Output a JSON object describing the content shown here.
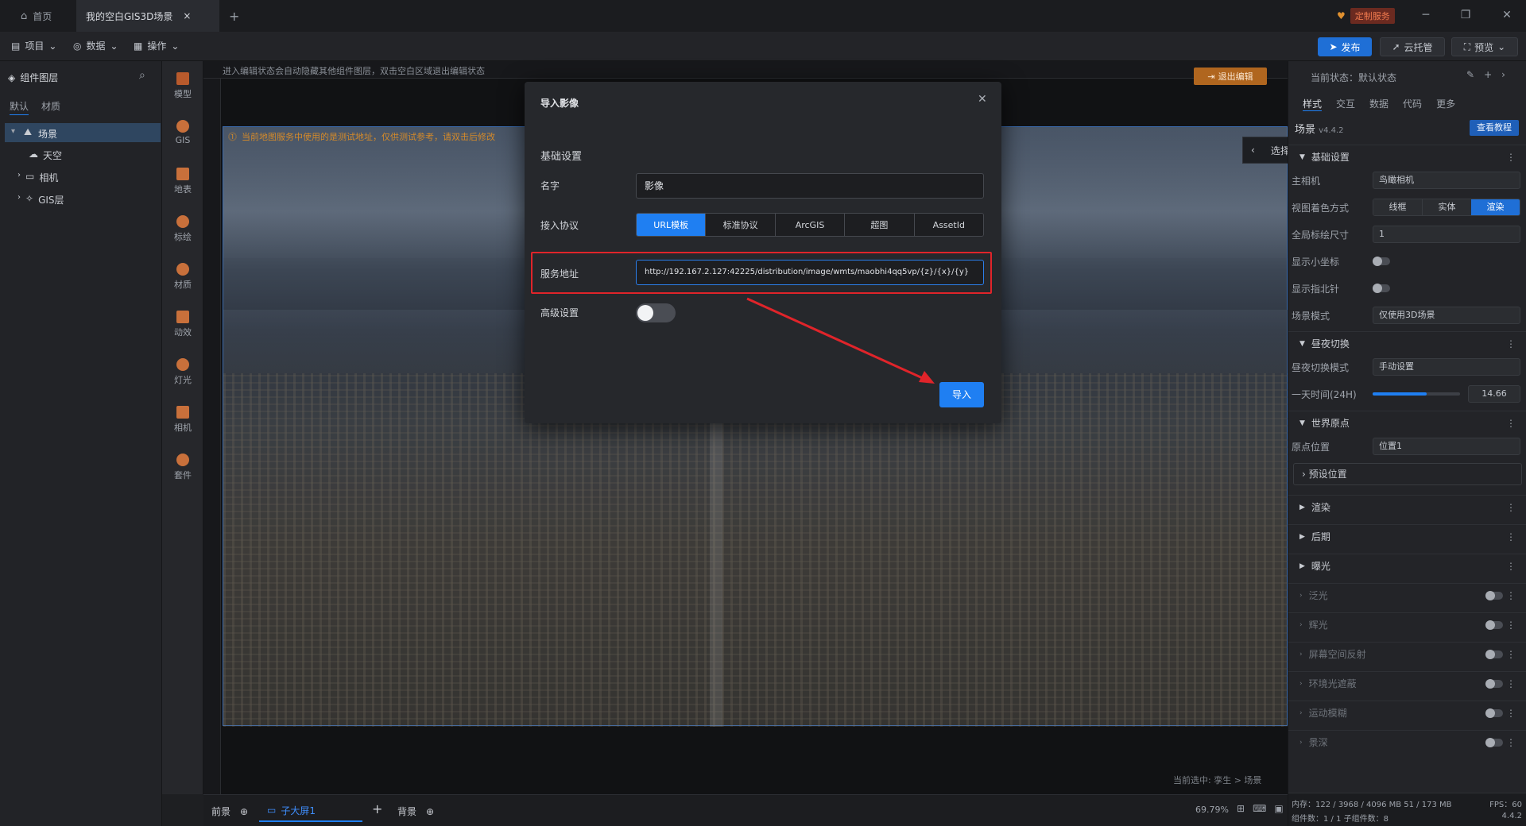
{
  "titlebar": {
    "home": "首页",
    "doc_tab": "我的空白GIS3D场景",
    "custom_service": "定制服务"
  },
  "menubar": {
    "project": "项目",
    "data": "数据",
    "operate": "操作",
    "publish": "发布",
    "cloud_host": "云托管",
    "preview": "预览"
  },
  "left_panel": {
    "title": "组件图层",
    "tabs": [
      "默认",
      "材质"
    ],
    "tree": [
      {
        "label": "场景",
        "level": 0
      },
      {
        "label": "天空",
        "level": 1
      },
      {
        "label": "相机",
        "level": 1
      },
      {
        "label": "GIS层",
        "level": 1
      }
    ]
  },
  "rail": [
    "模型",
    "GIS",
    "地表",
    "标绘",
    "材质",
    "动效",
    "灯光",
    "相机",
    "套件"
  ],
  "canvas": {
    "edit_hint": "进入编辑状态会自动隐藏其他组件图层，双击空白区域退出编辑状态",
    "exit_edit": "退出编辑",
    "warning": "当前地图服务中使用的是测试地址，仅供测试参考，请双击后修改",
    "select_region": "选择区域",
    "selected_path": "当前选中: 孪生 > 场景"
  },
  "bottom": {
    "foreground": "前景",
    "child_screen": "子大屏1",
    "background": "背景",
    "zoom": "69.79%"
  },
  "right_panel": {
    "state": "当前状态：默认状态",
    "tabs": [
      "样式",
      "交互",
      "数据",
      "代码",
      "更多"
    ],
    "scene_label": "场景",
    "version": "v4.4.2",
    "tutorial": "查看教程",
    "basic": "基础设置",
    "main_camera": "主相机",
    "main_camera_val": "鸟瞰相机",
    "view_color": "视图着色方式",
    "view_modes": [
      "线框",
      "实体",
      "渲染"
    ],
    "global_marker": "全局标绘尺寸",
    "global_marker_val": "1",
    "show_coord": "显示小坐标",
    "show_compass": "显示指北针",
    "scene_mode": "场景模式",
    "scene_mode_val": "仅使用3D场景",
    "daynight": "昼夜切换",
    "daynight_mode": "昼夜切换模式",
    "daynight_mode_val": "手动设置",
    "time": "一天时间(24H)",
    "time_val": "14.66",
    "time_level": 0.62,
    "world_origin": "世界原点",
    "origin_pos": "原点位置",
    "origin_pos_val": "位置1",
    "preset_pos": "预设位置",
    "sections": [
      "渲染",
      "后期",
      "曝光",
      "泛光",
      "辉光",
      "屏幕空间反射",
      "环境光遮蔽",
      "运动模糊",
      "景深"
    ],
    "stats_mem": "内存：122 / 3968 / 4096 MB  51 / 173 MB",
    "stats_fps": "FPS：60",
    "stats_comp": "组件数：1 / 1  子组件数：8",
    "stats_ver": "4.4.2"
  },
  "modal": {
    "title": "导入影像",
    "section": "基础设置",
    "name_label": "名字",
    "name_val": "影像",
    "protocol_label": "接入协议",
    "protocols": [
      "URL模板",
      "标准协议",
      "ArcGIS",
      "超图",
      "AssetId"
    ],
    "url_label": "服务地址",
    "url_val": "http://192.167.2.127:42225/distribution/image/wmts/maobhi4qq5vp/{z}/{x}/{y}",
    "advanced_label": "高级设置",
    "import": "导入"
  }
}
